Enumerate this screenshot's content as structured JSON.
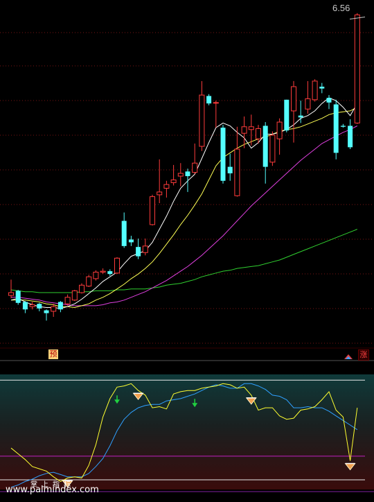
{
  "chart_data": [
    {
      "type": "candlestick",
      "last_price_label": "6.56",
      "grid": "dashed horizontal",
      "candles": [
        {
          "o": 3.55,
          "c": 3.58,
          "h": 3.72,
          "l": 3.52,
          "up": true
        },
        {
          "o": 3.6,
          "c": 3.47,
          "h": 3.61,
          "l": 3.45,
          "up": false
        },
        {
          "o": 3.48,
          "c": 3.4,
          "h": 3.49,
          "l": 3.36,
          "up": false
        },
        {
          "o": 3.43,
          "c": 3.45,
          "h": 3.48,
          "l": 3.4,
          "up": true
        },
        {
          "o": 3.46,
          "c": 3.41,
          "h": 3.47,
          "l": 3.38,
          "up": false
        },
        {
          "o": 3.39,
          "c": 3.36,
          "h": 3.4,
          "l": 3.28,
          "up": false
        },
        {
          "o": 3.38,
          "c": 3.43,
          "h": 3.46,
          "l": 3.32,
          "up": true
        },
        {
          "o": 3.48,
          "c": 3.4,
          "h": 3.49,
          "l": 3.37,
          "up": false
        },
        {
          "o": 3.46,
          "c": 3.53,
          "h": 3.56,
          "l": 3.44,
          "up": true
        },
        {
          "o": 3.5,
          "c": 3.6,
          "h": 3.61,
          "l": 3.49,
          "up": true
        },
        {
          "o": 3.58,
          "c": 3.66,
          "h": 3.68,
          "l": 3.57,
          "up": true
        },
        {
          "o": 3.65,
          "c": 3.75,
          "h": 3.77,
          "l": 3.64,
          "up": true
        },
        {
          "o": 3.73,
          "c": 3.8,
          "h": 3.82,
          "l": 3.71,
          "up": true
        },
        {
          "o": 3.8,
          "c": 3.81,
          "h": 3.84,
          "l": 3.78,
          "up": true
        },
        {
          "o": 3.81,
          "c": 3.78,
          "h": 3.83,
          "l": 3.76,
          "up": false
        },
        {
          "o": 3.79,
          "c": 3.95,
          "h": 3.96,
          "l": 3.78,
          "up": true
        },
        {
          "o": 4.35,
          "c": 4.08,
          "h": 4.44,
          "l": 4.06,
          "up": false
        },
        {
          "o": 4.15,
          "c": 4.12,
          "h": 4.19,
          "l": 4.08,
          "up": false
        },
        {
          "o": 4.07,
          "c": 3.97,
          "h": 4.16,
          "l": 3.94,
          "up": false
        },
        {
          "o": 4.01,
          "c": 4.08,
          "h": 4.16,
          "l": 3.98,
          "up": true
        },
        {
          "o": 4.31,
          "c": 4.61,
          "h": 4.63,
          "l": 4.3,
          "up": true
        },
        {
          "o": 4.63,
          "c": 4.66,
          "h": 5.01,
          "l": 4.54,
          "up": true
        },
        {
          "o": 4.7,
          "c": 4.74,
          "h": 4.78,
          "l": 4.6,
          "up": true
        },
        {
          "o": 4.76,
          "c": 4.79,
          "h": 4.95,
          "l": 4.73,
          "up": true
        },
        {
          "o": 4.83,
          "c": 4.86,
          "h": 4.97,
          "l": 4.72,
          "up": true
        },
        {
          "o": 4.88,
          "c": 4.83,
          "h": 4.91,
          "l": 4.66,
          "up": false
        },
        {
          "o": 4.87,
          "c": 4.97,
          "h": 5.18,
          "l": 4.85,
          "up": true
        },
        {
          "o": 5.15,
          "c": 5.7,
          "h": 5.85,
          "l": 5.1,
          "up": true
        },
        {
          "o": 5.69,
          "c": 5.61,
          "h": 5.71,
          "l": 5.59,
          "up": false
        },
        {
          "o": 5.62,
          "c": 5.62,
          "h": 5.64,
          "l": 5.35,
          "up": true
        },
        {
          "o": 5.35,
          "c": 4.78,
          "h": 5.38,
          "l": 4.75,
          "up": false
        },
        {
          "o": 4.93,
          "c": 4.86,
          "h": 5.07,
          "l": 4.78,
          "up": false
        },
        {
          "o": 4.62,
          "c": 5.12,
          "h": 5.36,
          "l": 4.61,
          "up": true
        },
        {
          "o": 5.29,
          "c": 5.36,
          "h": 5.47,
          "l": 5.13,
          "up": true
        },
        {
          "o": 5.33,
          "c": 5.36,
          "h": 5.49,
          "l": 5.16,
          "up": true
        },
        {
          "o": 5.23,
          "c": 5.34,
          "h": 5.38,
          "l": 5.18,
          "up": true
        },
        {
          "o": 5.37,
          "c": 4.93,
          "h": 5.41,
          "l": 4.75,
          "up": false
        },
        {
          "o": 4.98,
          "c": 5.27,
          "h": 5.31,
          "l": 4.94,
          "up": true
        },
        {
          "o": 5.23,
          "c": 5.41,
          "h": 5.45,
          "l": 5.06,
          "up": true
        },
        {
          "o": 5.65,
          "c": 5.32,
          "h": 5.65,
          "l": 5.3,
          "up": false
        },
        {
          "o": 5.53,
          "c": 5.79,
          "h": 5.85,
          "l": 5.19,
          "up": true
        },
        {
          "o": 5.48,
          "c": 5.46,
          "h": 5.64,
          "l": 5.4,
          "up": false
        },
        {
          "o": 5.55,
          "c": 5.66,
          "h": 5.85,
          "l": 5.5,
          "up": true
        },
        {
          "o": 5.65,
          "c": 5.85,
          "h": 5.87,
          "l": 5.63,
          "up": true
        },
        {
          "o": 5.79,
          "c": 5.77,
          "h": 5.83,
          "l": 5.72,
          "up": false
        },
        {
          "o": 5.67,
          "c": 5.62,
          "h": 5.7,
          "l": 5.55,
          "up": false
        },
        {
          "o": 5.6,
          "c": 5.08,
          "h": 5.65,
          "l": 5.01,
          "up": false
        },
        {
          "o": 5.37,
          "c": 5.36,
          "h": 5.39,
          "l": 5.35,
          "up": false
        },
        {
          "o": 5.37,
          "c": 5.14,
          "h": 5.44,
          "l": 5.12,
          "up": false
        },
        {
          "o": 5.4,
          "c": 6.56,
          "h": 6.58,
          "l": 5.39,
          "up": true
        }
      ],
      "ma_short": [
        3.5,
        3.52,
        3.48,
        3.45,
        3.43,
        3.42,
        3.42,
        3.41,
        3.43,
        3.46,
        3.51,
        3.57,
        3.63,
        3.7,
        3.75,
        3.8,
        3.89,
        3.97,
        4.0,
        4.03,
        4.12,
        4.26,
        4.4,
        4.56,
        4.7,
        4.78,
        4.85,
        5.02,
        5.19,
        5.35,
        5.4,
        5.37,
        5.3,
        5.24,
        5.13,
        5.19,
        5.28,
        5.28,
        5.3,
        5.33,
        5.38,
        5.45,
        5.48,
        5.53,
        5.61,
        5.67,
        5.64,
        5.57,
        5.48,
        5.61
      ],
      "ma_mid": [
        3.5,
        3.5,
        3.5,
        3.49,
        3.48,
        3.46,
        3.45,
        3.43,
        3.43,
        3.42,
        3.44,
        3.46,
        3.5,
        3.53,
        3.57,
        3.62,
        3.67,
        3.73,
        3.78,
        3.84,
        3.91,
        4.0,
        4.1,
        4.2,
        4.31,
        4.41,
        4.52,
        4.64,
        4.79,
        4.94,
        5.03,
        5.08,
        5.13,
        5.17,
        5.2,
        5.23,
        5.25,
        5.28,
        5.31,
        5.33,
        5.34,
        5.36,
        5.39,
        5.42,
        5.45,
        5.49,
        5.51,
        5.52,
        5.53,
        5.57
      ],
      "ma_long": [
        3.53,
        3.53,
        3.52,
        3.51,
        3.5,
        3.48,
        3.47,
        3.46,
        3.45,
        3.44,
        3.44,
        3.44,
        3.44,
        3.45,
        3.47,
        3.48,
        3.5,
        3.53,
        3.56,
        3.59,
        3.63,
        3.67,
        3.71,
        3.76,
        3.81,
        3.86,
        3.92,
        3.98,
        4.05,
        4.12,
        4.19,
        4.27,
        4.35,
        4.43,
        4.51,
        4.58,
        4.65,
        4.72,
        4.79,
        4.86,
        4.93,
        5.0,
        5.06,
        5.12,
        5.18,
        5.22,
        5.26,
        5.3,
        5.33,
        5.37
      ],
      "ma_very_long": [
        3.61,
        3.6,
        3.59,
        3.59,
        3.58,
        3.58,
        3.58,
        3.58,
        3.58,
        3.58,
        3.59,
        3.59,
        3.6,
        3.6,
        3.6,
        3.61,
        3.61,
        3.62,
        3.62,
        3.62,
        3.63,
        3.64,
        3.66,
        3.67,
        3.68,
        3.7,
        3.72,
        3.75,
        3.77,
        3.79,
        3.81,
        3.82,
        3.84,
        3.85,
        3.86,
        3.87,
        3.89,
        3.91,
        3.93,
        3.96,
        3.99,
        4.02,
        4.05,
        4.08,
        4.11,
        4.14,
        4.17,
        4.2,
        4.23,
        4.26
      ],
      "ylim": [
        3.0,
        6.72
      ],
      "colors": {
        "up": "#ff3b3b",
        "down": "#54ffff",
        "ma_short": "#ffffff",
        "ma_mid": "#ffff55",
        "ma_long": "#e040e0",
        "ma_very_long": "#30d030"
      }
    },
    {
      "type": "line",
      "ylim": [
        0,
        100
      ],
      "upper_level": 95,
      "lower_level": 29,
      "series": [
        {
          "values": [
            36,
            31,
            26,
            20,
            18,
            16,
            11,
            7,
            10,
            11,
            10,
            21,
            39,
            63,
            79,
            89,
            90,
            92,
            86,
            82,
            71,
            72,
            70,
            83,
            85,
            86,
            86,
            88,
            89,
            90,
            92,
            91,
            88,
            89,
            82,
            69,
            71,
            71,
            64,
            61,
            62,
            69,
            70,
            72,
            78,
            85,
            69,
            63,
            25,
            71
          ],
          "color": "#ffff30"
        },
        {
          "values": [
            2,
            4,
            7,
            9,
            12,
            14,
            15,
            13,
            11,
            11,
            11,
            14,
            20,
            27,
            38,
            51,
            61,
            67,
            71,
            73,
            74,
            74,
            77,
            78,
            79,
            81,
            83,
            86,
            89,
            91,
            90,
            88,
            88,
            92,
            92,
            90,
            87,
            82,
            81,
            78,
            71,
            71,
            72,
            71,
            71,
            68,
            64,
            60,
            56,
            52
          ],
          "color": "#2fa0ff"
        }
      ],
      "signals": {
        "down_arrows": [
          15,
          26
        ],
        "diamonds": [
          8,
          18,
          34,
          48
        ]
      }
    }
  ],
  "badges": {
    "left": "预",
    "right": "涨"
  },
  "watermark": {
    "cn": "掌上指标",
    "url": "www.palmindex.com"
  }
}
